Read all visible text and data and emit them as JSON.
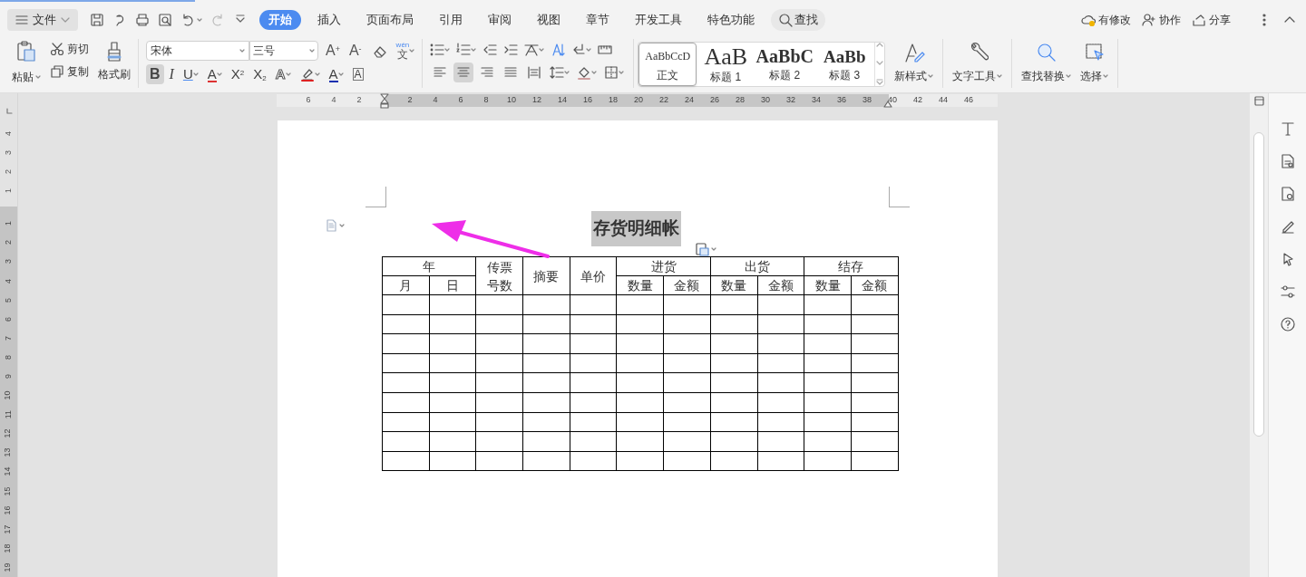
{
  "file_menu": {
    "label": "文件"
  },
  "menu_tabs": [
    {
      "label": "开始",
      "selected": true
    },
    {
      "label": "插入",
      "selected": false
    },
    {
      "label": "页面布局",
      "selected": false
    },
    {
      "label": "引用",
      "selected": false
    },
    {
      "label": "审阅",
      "selected": false
    },
    {
      "label": "视图",
      "selected": false
    },
    {
      "label": "章节",
      "selected": false
    },
    {
      "label": "开发工具",
      "selected": false
    },
    {
      "label": "特色功能",
      "selected": false
    }
  ],
  "search": {
    "label": "查找"
  },
  "account_actions": [
    {
      "kind": "changes",
      "label": "有修改"
    },
    {
      "kind": "collaborate",
      "label": "协作"
    },
    {
      "kind": "share",
      "label": "分享"
    }
  ],
  "clipboard": {
    "paste": "粘贴",
    "cut": "剪切",
    "copy": "复制",
    "format_painter": "格式刷"
  },
  "font": {
    "name": "宋体",
    "size": "三号"
  },
  "font_tools": [
    {
      "kind": "grow",
      "glyph": "A",
      "mark": "+"
    },
    {
      "kind": "shrink",
      "glyph": "A",
      "mark": "-"
    },
    {
      "kind": "clear"
    },
    {
      "kind": "pinyin",
      "glyph": "文",
      "mark": "wén"
    }
  ],
  "format_buttons": [
    {
      "kind": "bold",
      "glyph": "B",
      "selected": true
    },
    {
      "kind": "italic",
      "glyph": "I",
      "selected": false
    },
    {
      "kind": "underline",
      "glyph": "U",
      "selected": false
    },
    {
      "kind": "strikethrough",
      "glyph": "A",
      "selected": false
    },
    {
      "kind": "superscript",
      "glyph": "X",
      "mark": "2",
      "selected": false
    },
    {
      "kind": "subscript",
      "glyph": "X",
      "mark": "2",
      "selected": false
    },
    {
      "kind": "effect",
      "glyph": "A",
      "selected": false
    },
    {
      "kind": "highlight",
      "selected": false
    },
    {
      "kind": "font_color",
      "glyph": "A",
      "selected": false
    },
    {
      "kind": "char_border",
      "glyph": "A",
      "selected": false
    }
  ],
  "alignment": [
    {
      "kind": "left",
      "selected": false
    },
    {
      "kind": "center",
      "selected": true
    },
    {
      "kind": "right",
      "selected": false
    },
    {
      "kind": "justify",
      "selected": false
    },
    {
      "kind": "distributed",
      "selected": false
    }
  ],
  "styles": [
    {
      "preview": "AaBbCcD",
      "name": "正文",
      "selected": true
    },
    {
      "preview": "AaB",
      "name": "标题 1",
      "selected": false
    },
    {
      "preview": "AaBbC",
      "name": "标题 2",
      "selected": false
    },
    {
      "preview": "AaBb",
      "name": "标题 3",
      "selected": false
    }
  ],
  "big_tools": [
    {
      "kind": "new_style",
      "label": "新样式"
    },
    {
      "kind": "text_tools",
      "label": "文字工具"
    },
    {
      "kind": "find_replace",
      "label": "查找替换"
    },
    {
      "kind": "select",
      "label": "选择"
    }
  ],
  "ruler": {
    "left_labels": [
      "6",
      "4",
      "2"
    ],
    "right_labels": [
      "2",
      "4",
      "6",
      "8",
      "10",
      "12",
      "14",
      "16",
      "18",
      "20",
      "22",
      "24",
      "26",
      "28",
      "30",
      "32",
      "34",
      "36",
      "38",
      "40",
      "42",
      "44",
      "46"
    ],
    "top_labels": [
      "4",
      "3",
      "2",
      "1"
    ],
    "body_labels": [
      "1",
      "2",
      "3",
      "4",
      "5",
      "6",
      "7",
      "8",
      "9",
      "10",
      "11",
      "12",
      "13",
      "14",
      "15",
      "16",
      "17",
      "18",
      "19"
    ]
  },
  "document": {
    "title": "存货明细帐",
    "title_selected": true,
    "table": {
      "header": [
        {
          "label": "年",
          "sub": [
            "月",
            "日"
          ]
        },
        {
          "label": "传票号数"
        },
        {
          "label": "摘要"
        },
        {
          "label": "单价"
        },
        {
          "label": "进货",
          "sub": [
            "数量",
            "金额"
          ]
        },
        {
          "label": "出货",
          "sub": [
            "数量",
            "金额"
          ]
        },
        {
          "label": "结存",
          "sub": [
            "数量",
            "金额"
          ]
        }
      ],
      "body_rows": [
        {
          "kind": "blank"
        },
        {
          "kind": "blank"
        },
        {
          "kind": "blank"
        },
        {
          "kind": "blank"
        },
        {
          "kind": "blank"
        },
        {
          "kind": "blank"
        },
        {
          "kind": "blank"
        },
        {
          "kind": "blank"
        },
        {
          "kind": "blank"
        }
      ]
    }
  }
}
